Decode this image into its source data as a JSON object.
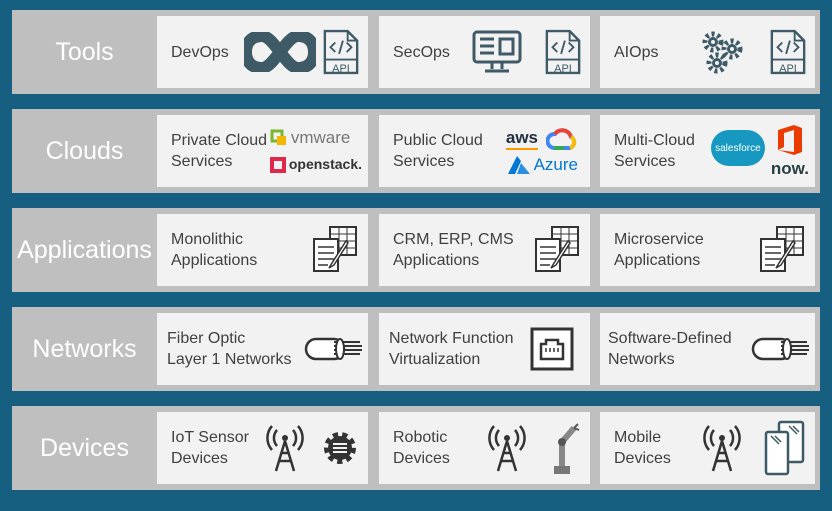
{
  "rows": [
    {
      "label": "Tools",
      "cards": [
        {
          "text": "DevOps",
          "icons": [
            "devops-loop-icon",
            "api-file-icon"
          ]
        },
        {
          "text": "SecOps",
          "icons": [
            "monitor-icon",
            "api-file-icon"
          ]
        },
        {
          "text": "AIOps",
          "icons": [
            "gears-icon",
            "api-file-icon"
          ]
        }
      ]
    },
    {
      "label": "Clouds",
      "cards": [
        {
          "line1": "Private Cloud",
          "line2": "Services",
          "logos": [
            "vmware",
            "openstack."
          ]
        },
        {
          "line1": "Public Cloud",
          "line2": "Services",
          "logos": [
            "aws",
            "Azure"
          ]
        },
        {
          "line1": "Multi-Cloud",
          "line2": "Services",
          "logos": [
            "salesforce",
            "now."
          ]
        }
      ]
    },
    {
      "label": "Applications",
      "cards": [
        {
          "line1": "Monolithic",
          "line2": "Applications"
        },
        {
          "line1": "CRM, ERP, CMS",
          "line2": "Applications"
        },
        {
          "line1": "Microservice",
          "line2": "Applications"
        }
      ]
    },
    {
      "label": "Networks",
      "cards": [
        {
          "line1": "Fiber Optic",
          "line2": "Layer 1 Networks"
        },
        {
          "line1": "Network Function",
          "line2": "Virtualization"
        },
        {
          "line1": "Software-Defined",
          "line2": "Networks"
        }
      ]
    },
    {
      "label": "Devices",
      "cards": [
        {
          "line1": "IoT Sensor",
          "line2": "Devices"
        },
        {
          "line1": "Robotic",
          "line2": "Devices"
        },
        {
          "line1": "Mobile",
          "line2": "Devices"
        }
      ]
    }
  ],
  "api_label": "API",
  "colors": {
    "background": "#175f80",
    "band": "#bfbfbf",
    "card": "#f2f2f2",
    "icon": "#3d5a66"
  }
}
